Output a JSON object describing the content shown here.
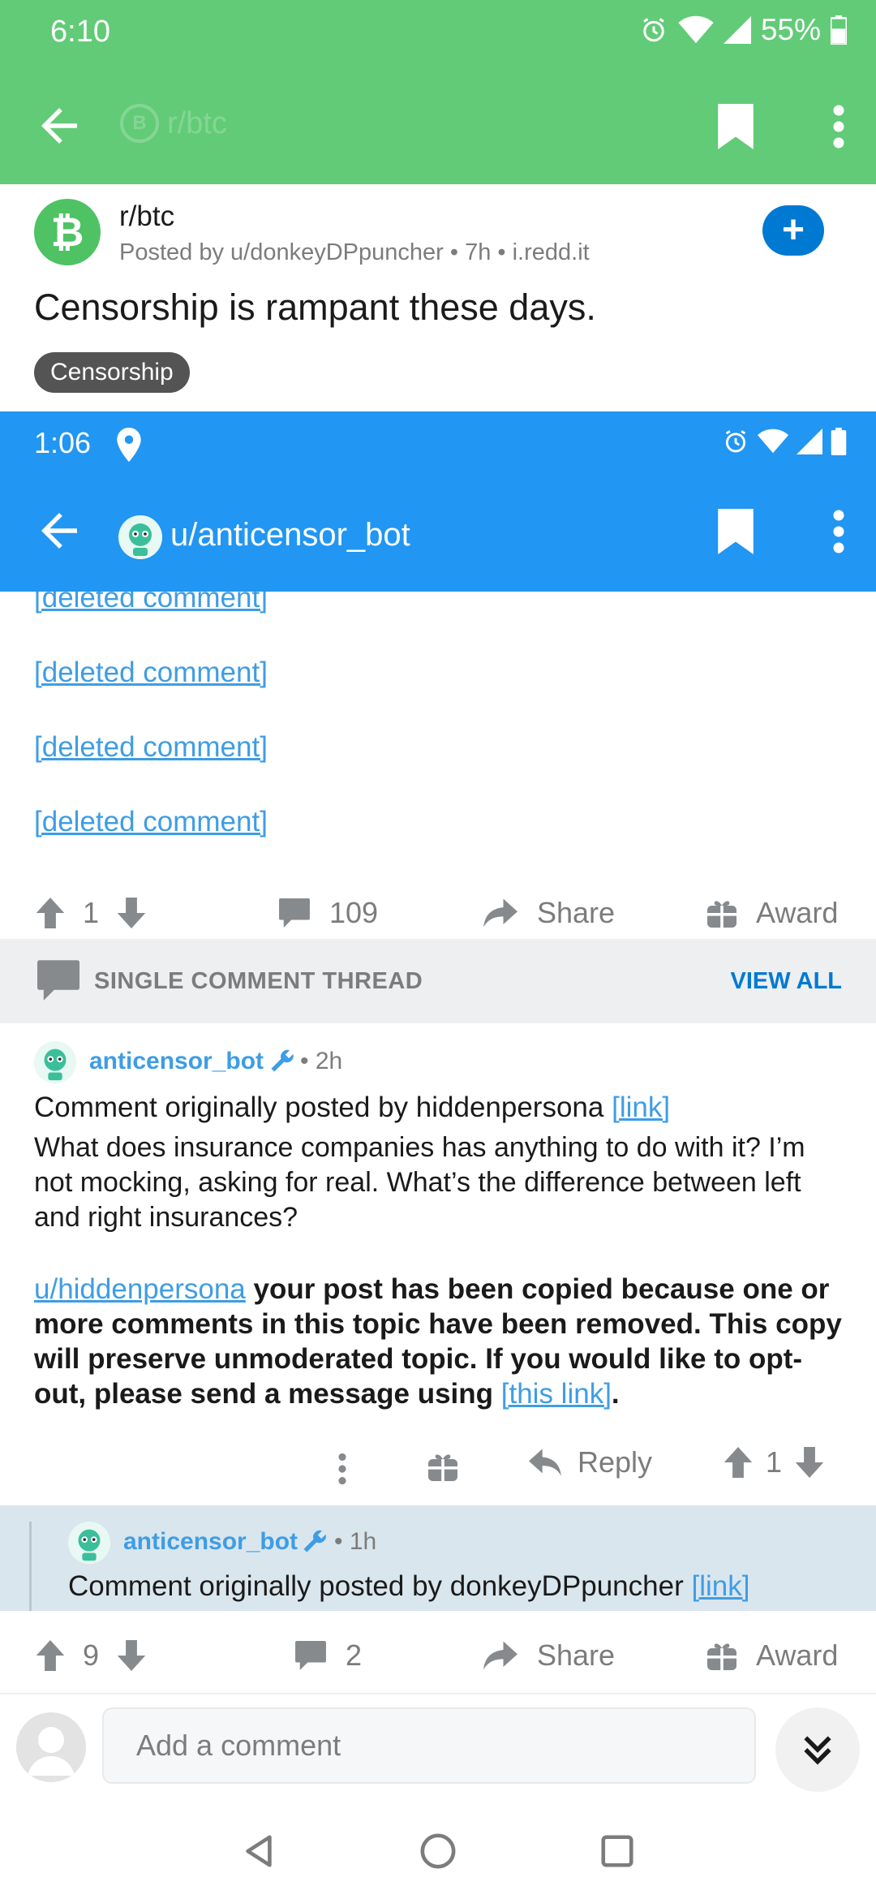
{
  "colors": {
    "outer_header": "#62cb77",
    "inner_header": "#2196f3",
    "link": "#3e9de4",
    "accent": "#0079d3",
    "thread_bar": "#edeff1",
    "nested_bg": "#dae6ee"
  },
  "outer_status": {
    "time": "6:10",
    "battery": "55%"
  },
  "outer_toolbar": {
    "faded_title": "r/btc",
    "faded_icon": "B"
  },
  "post": {
    "subreddit": "r/btc",
    "subreddit_icon": "₿",
    "meta": "Posted by u/donkeyDPpuncher • 7h • i.redd.it",
    "join_label": "+",
    "title": "Censorship is rampant these days.",
    "flair": "Censorship"
  },
  "inner_status": {
    "time": "1:06"
  },
  "inner_toolbar": {
    "title": "u/anticensor_bot"
  },
  "deleted_comments": [
    "[deleted comment]",
    "[deleted comment]",
    "[deleted comment]",
    "[deleted comment]"
  ],
  "post_actions": {
    "votes": "1",
    "comments": "109",
    "share": "Share",
    "award": "Award"
  },
  "thread_bar": {
    "label": "SINGLE COMMENT THREAD",
    "view_all": "VIEW ALL"
  },
  "comment": {
    "author": "anticensor_bot",
    "time": "• 2h",
    "line1_text": "Comment originally posted by hiddenpersona ",
    "line1_link": "[link]",
    "quote": "What does insurance companies has anything to do with it? I’m not mocking, asking for real.  What’s the difference between left and right insurances?",
    "notice_user": "u/hiddenpersona",
    "notice_text": " your post has been copied because one or more comments in this topic have been removed. This copy will preserve unmoderated topic. If you would like to opt-out, please send a message using ",
    "notice_link": "[this link]",
    "notice_end": ".",
    "reply": "Reply",
    "votes": "1"
  },
  "nested_comment": {
    "author": "anticensor_bot",
    "time": "• 1h",
    "line1_text": "Comment originally posted by donkeyDPpuncher ",
    "line1_link": "[link]"
  },
  "outer_actions": {
    "votes": "9",
    "comments": "2",
    "share": "Share",
    "award": "Award"
  },
  "compose": {
    "placeholder": "Add a comment"
  }
}
